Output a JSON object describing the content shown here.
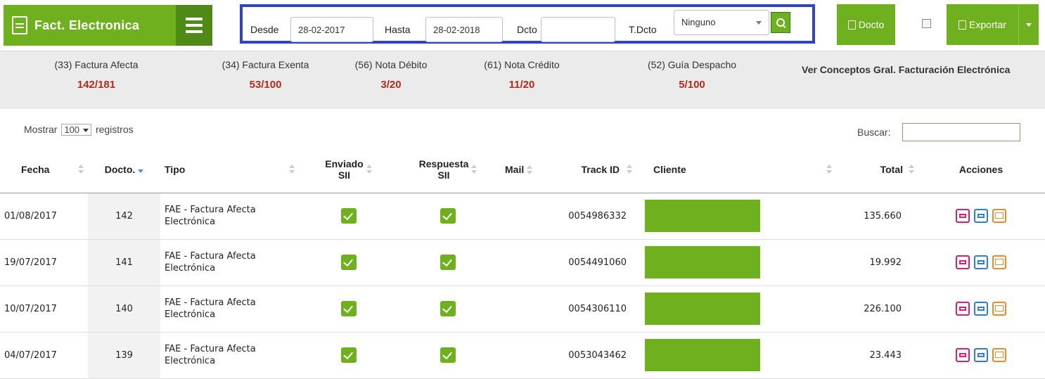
{
  "brand": {
    "title": "Fact. Electronica"
  },
  "filter": {
    "desde_label": "Desde",
    "desde_value": "28-02-2017",
    "hasta_label": "Hasta",
    "hasta_value": "28-02-2018",
    "dcto_label": "Dcto",
    "dcto_value": "",
    "tdcto_label": "T.Dcto",
    "tdcto_selected": "Ninguno"
  },
  "toolbar": {
    "docto_label": "Docto",
    "export_label": "Exportar"
  },
  "stats": [
    {
      "name": "(33) Factura Afecta",
      "value": "142/181"
    },
    {
      "name": "(34) Factura Exenta",
      "value": "53/100"
    },
    {
      "name": "(56) Nota Débito",
      "value": "3/20"
    },
    {
      "name": "(61) Nota Crédito",
      "value": "11/20"
    },
    {
      "name": "(52) Guía Despacho",
      "value": "5/100"
    }
  ],
  "concepts_link": "Ver Conceptos Gral. Facturación Electrónica",
  "list": {
    "show_prefix": "Mostrar",
    "page_length": "100",
    "show_suffix": "registros",
    "search_label": "Buscar:"
  },
  "columns": {
    "fecha": "Fecha",
    "docto": "Docto.",
    "tipo": "Tipo",
    "enviado_l1": "Enviado",
    "enviado_l2": "SII",
    "respuesta_l1": "Respuesta",
    "respuesta_l2": "SII",
    "mail": "Mail",
    "track": "Track ID",
    "cliente": "Cliente",
    "total": "Total",
    "acciones": "Acciones"
  },
  "rows": [
    {
      "fecha": "01/08/2017",
      "docto": "142",
      "tipo_l1": "FAE - Factura Afecta",
      "tipo_l2": "Electrónica",
      "track": "0054986332",
      "total": "135.660"
    },
    {
      "fecha": "19/07/2017",
      "docto": "141",
      "tipo_l1": "FAE - Factura Afecta",
      "tipo_l2": "Electrónica",
      "track": "0054491060",
      "total": "19.992"
    },
    {
      "fecha": "10/07/2017",
      "docto": "140",
      "tipo_l1": "FAE - Factura Afecta",
      "tipo_l2": "Electrónica",
      "track": "0054306110",
      "total": "226.100"
    },
    {
      "fecha": "04/07/2017",
      "docto": "139",
      "tipo_l1": "FAE - Factura Afecta",
      "tipo_l2": "Electrónica",
      "track": "0053043462",
      "total": "23.443"
    }
  ],
  "colors": {
    "green": "#6fb01f",
    "dark_green": "#4f8a17",
    "filter_border": "#3142c4",
    "stat_value": "#b52a1c"
  },
  "icons": [
    "document-icon",
    "menu-icon",
    "search-icon",
    "checkmark-icon",
    "print-icon",
    "mail-icon"
  ]
}
